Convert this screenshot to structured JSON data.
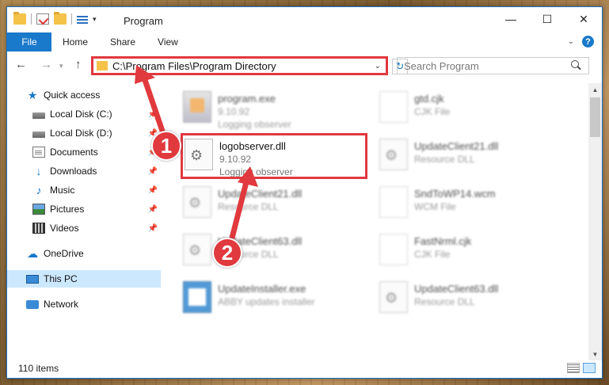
{
  "window": {
    "title": "Program",
    "controls": {
      "minimize": "—",
      "maximize": "☐",
      "close": "✕"
    }
  },
  "ribbon": {
    "file_tab": "File",
    "tabs": [
      "Home",
      "Share",
      "View"
    ],
    "help": "?"
  },
  "address": {
    "path": "C:\\Program Files\\Program Directory",
    "search_placeholder": "Search Program"
  },
  "nav": {
    "items": [
      {
        "label": "Quick access",
        "icon": "star-icon"
      },
      {
        "label": "Local Disk (C:)",
        "icon": "disk-icon",
        "pinned": true
      },
      {
        "label": "Local Disk (D:)",
        "icon": "disk-icon",
        "pinned": true
      },
      {
        "label": "Documents",
        "icon": "documents-icon",
        "pinned": true
      },
      {
        "label": "Downloads",
        "icon": "download-icon",
        "pinned": true
      },
      {
        "label": "Music",
        "icon": "music-icon",
        "pinned": true
      },
      {
        "label": "Pictures",
        "icon": "pictures-icon",
        "pinned": true
      },
      {
        "label": "Videos",
        "icon": "videos-icon",
        "pinned": true
      },
      {
        "label": "OneDrive",
        "icon": "cloud-icon"
      },
      {
        "label": "This PC",
        "icon": "pc-icon",
        "selected": true
      },
      {
        "label": "Network",
        "icon": "network-icon"
      }
    ]
  },
  "files": [
    {
      "name": "program.exe",
      "line2": "9.10.92",
      "line3": "Logging observer",
      "icon": "exe-icon"
    },
    {
      "name": "gtd.cjk",
      "line2": "CJK File",
      "icon": "cjk-file-icon"
    },
    {
      "name": "logobserver.dll",
      "line2": "9.10.92",
      "line3": "Logging observer",
      "icon": "dll-gear-icon",
      "highlighted": true
    },
    {
      "name": "UpdateClient21.dll",
      "line2": "Resource DLL",
      "icon": "dll-gear-icon"
    },
    {
      "name": "UpdateClient21.dll",
      "line2": "Resource DLL",
      "icon": "dll-gear-icon"
    },
    {
      "name": "SndToWP14.wcm",
      "line2": "WCM File",
      "icon": "wcm-file-icon"
    },
    {
      "name": "UpdateClient63.dll",
      "line2": "Resource DLL",
      "icon": "dll-gear-icon"
    },
    {
      "name": "FastNrml.cjk",
      "line2": "CJK File",
      "icon": "cjk-file-icon"
    },
    {
      "name": "UpdateInstaller.exe",
      "line2": "ABBY updates installer",
      "icon": "installer-icon"
    },
    {
      "name": "UpdateClient63.dll",
      "line2": "Resource DLL",
      "icon": "dll-gear-icon"
    }
  ],
  "status": {
    "items_count": "110 items"
  },
  "callouts": [
    {
      "label": "1"
    },
    {
      "label": "2"
    }
  ],
  "colors": {
    "accent": "#1979ca",
    "callout_red": "#e0393e",
    "selected_bg": "#cce8ff"
  }
}
